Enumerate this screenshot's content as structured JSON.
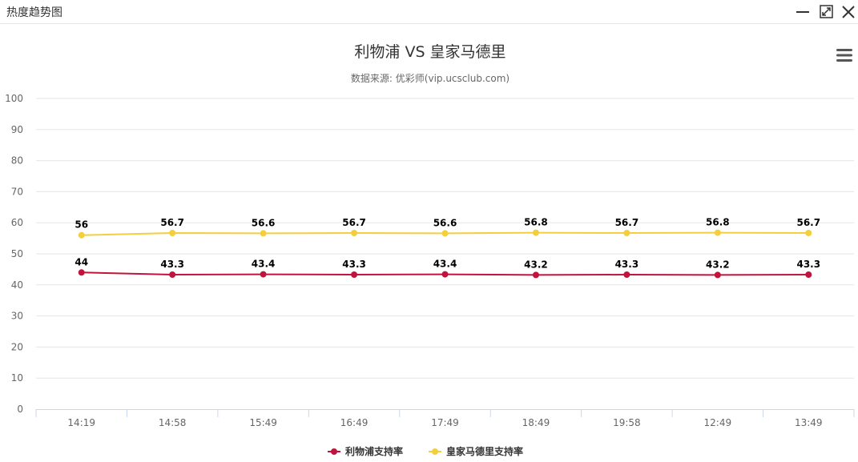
{
  "panel": {
    "title": "热度趋势图"
  },
  "icons": {
    "minimize": "minimize-icon",
    "maximize": "maximize-icon",
    "close": "close-icon",
    "menu": "hamburger-menu-icon"
  },
  "chart_data": {
    "type": "line",
    "title": "利物浦 VS 皇家马德里",
    "subtitle": "数据来源: 优彩师(vip.ucsclub.com)",
    "categories": [
      "14:19",
      "14:58",
      "15:49",
      "16:49",
      "17:49",
      "18:49",
      "19:58",
      "12:49",
      "13:49"
    ],
    "series": [
      {
        "name": "利物浦支持率",
        "color": "#c0143c",
        "values": [
          44,
          43.3,
          43.4,
          43.3,
          43.4,
          43.2,
          43.3,
          43.2,
          43.3
        ]
      },
      {
        "name": "皇家马德里支持率",
        "color": "#f4cf3d",
        "values": [
          56,
          56.7,
          56.6,
          56.7,
          56.6,
          56.8,
          56.7,
          56.8,
          56.7
        ]
      }
    ],
    "ylim": [
      0,
      100
    ],
    "yticks": [
      0,
      10,
      20,
      30,
      40,
      50,
      60,
      70,
      80,
      90,
      100
    ],
    "grid": true,
    "legend": "bottom-center",
    "data_labels": true
  }
}
